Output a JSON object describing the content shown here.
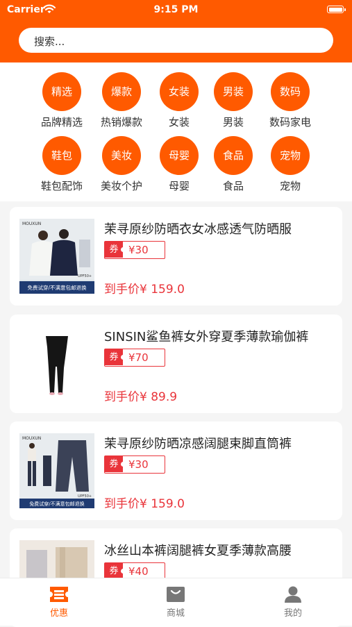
{
  "status_bar": {
    "carrier": "Carrier",
    "time": "9:15 PM"
  },
  "search": {
    "placeholder": "搜索..."
  },
  "categories": [
    {
      "icon": "精选",
      "label": "品牌精选"
    },
    {
      "icon": "爆款",
      "label": "热销爆款"
    },
    {
      "icon": "女装",
      "label": "女装"
    },
    {
      "icon": "男装",
      "label": "男装"
    },
    {
      "icon": "数码",
      "label": "数码家电"
    },
    {
      "icon": "鞋包",
      "label": "鞋包配饰"
    },
    {
      "icon": "美妆",
      "label": "美妆个护"
    },
    {
      "icon": "母婴",
      "label": "母婴"
    },
    {
      "icon": "食品",
      "label": "食品"
    },
    {
      "icon": "宠物",
      "label": "宠物"
    }
  ],
  "coupon_tag": "券",
  "products": [
    {
      "title": "茉寻原纱防晒衣女冰感透气防晒服",
      "coupon": "¥30",
      "final_price": "到手价¥ 159.0",
      "thumb_text": {
        "brand": "MOUXUN",
        "spec": "UPF50+",
        "banner": "免费试穿/不满意包邮退换"
      }
    },
    {
      "title": "SINSIN鲨鱼裤女外穿夏季薄款瑜伽裤",
      "coupon": "¥70",
      "final_price": "到手价¥ 89.9"
    },
    {
      "title": "茉寻原纱防晒凉感阔腿束脚直筒裤",
      "coupon": "¥30",
      "final_price": "到手价¥ 159.0",
      "thumb_text": {
        "brand": "MOUXUN",
        "spec": "UPF50+",
        "banner": "免费试穿/不满意包邮退换"
      }
    },
    {
      "title": "冰丝山本裤阔腿裤女夏季薄款高腰",
      "coupon": "¥40",
      "final_price": ""
    }
  ],
  "tabbar": [
    {
      "label": "优惠",
      "icon": "coupon-icon",
      "active": true
    },
    {
      "label": "商城",
      "icon": "shop-bag-icon",
      "active": false
    },
    {
      "label": "我的",
      "icon": "person-icon",
      "active": false
    }
  ],
  "colors": {
    "brand": "#ff5a00",
    "price_red": "#e9343a",
    "tab_inactive": "#777777"
  }
}
